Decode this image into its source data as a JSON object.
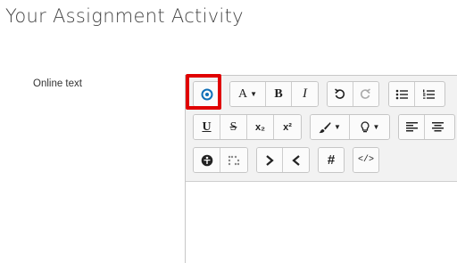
{
  "page": {
    "title": "Your Assignment Activity"
  },
  "field": {
    "label": "Online text"
  },
  "toolbar": {
    "row1": {
      "toggle_icon": "toggle-toolbar-icon",
      "font_size_label": "A",
      "bold_label": "B",
      "italic_label": "I",
      "undo_icon": "undo-icon",
      "redo_icon": "redo-icon",
      "unordered_list_icon": "unordered-list-icon",
      "ordered_list_icon": "ordered-list-icon"
    },
    "row2": {
      "underline_label": "U",
      "strike_label": "S",
      "subscript_label": "x₂",
      "superscript_label": "x²",
      "text_color_icon": "brush-icon",
      "background_color_icon": "lightbulb-icon",
      "align_left_icon": "align-left-icon",
      "align_center_icon": "align-center-icon"
    },
    "row3": {
      "accessibility_icon": "accessibility-icon",
      "braille_icon": "braille-icon",
      "indent_icon": "indent-icon",
      "outdent_icon": "outdent-icon",
      "hash_label": "#",
      "code_label": "</>"
    }
  },
  "colors": {
    "highlight": "#e00000",
    "accent_icon": "#0f6fb8"
  }
}
